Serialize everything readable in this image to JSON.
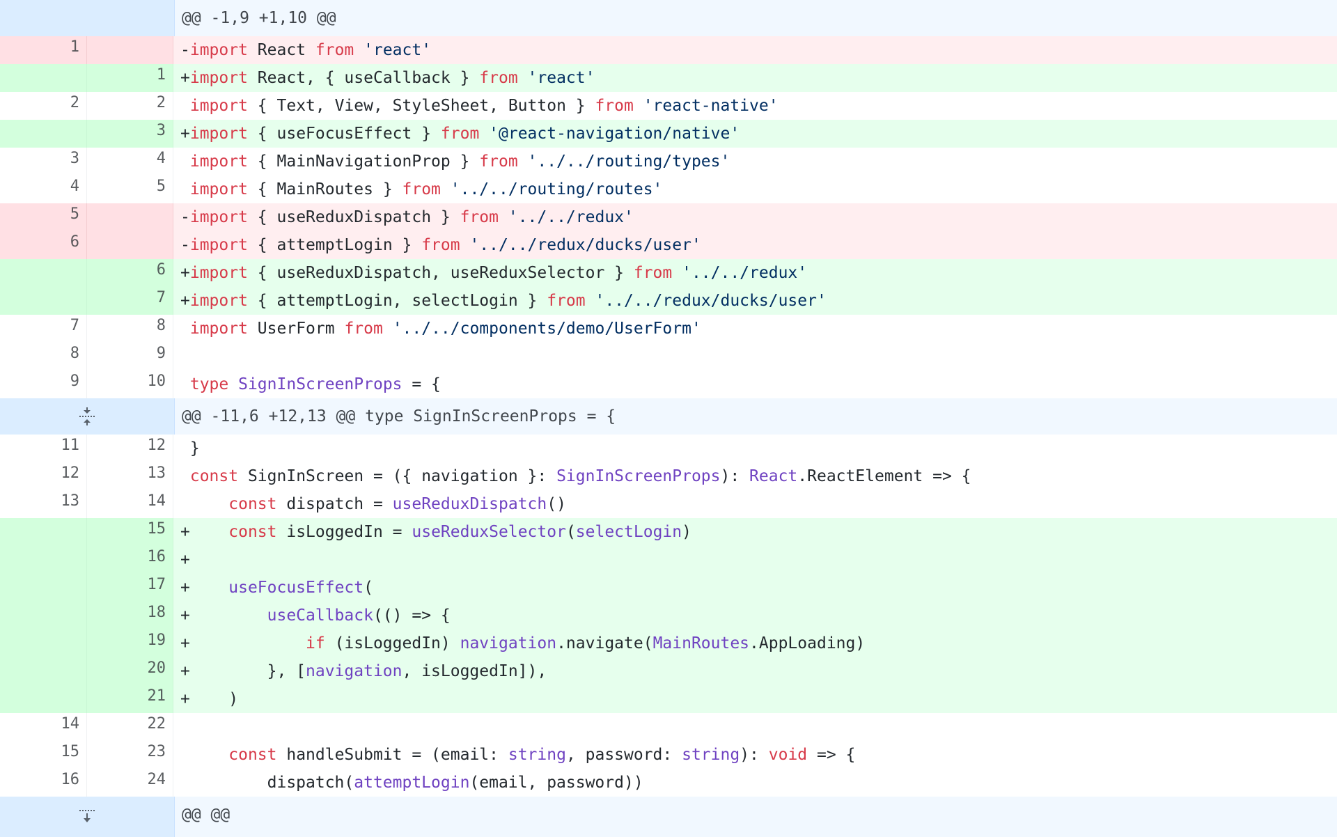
{
  "diff": {
    "rows": [
      {
        "type": "hunk",
        "header": "@@ -1,9 +1,10 @@",
        "expand": "none"
      },
      {
        "type": "del",
        "old": "1",
        "new": "",
        "tokens": [
          {
            "t": "-"
          },
          {
            "t": "import",
            "c": "k"
          },
          {
            "t": " React "
          },
          {
            "t": "from",
            "c": "k"
          },
          {
            "t": " "
          },
          {
            "t": "'react'",
            "c": "s"
          }
        ]
      },
      {
        "type": "add",
        "old": "",
        "new": "1",
        "tokens": [
          {
            "t": "+"
          },
          {
            "t": "import",
            "c": "k"
          },
          {
            "t": " React, { useCallback } "
          },
          {
            "t": "from",
            "c": "k"
          },
          {
            "t": " "
          },
          {
            "t": "'react'",
            "c": "s"
          }
        ]
      },
      {
        "type": "ctx",
        "old": "2",
        "new": "2",
        "tokens": [
          {
            "t": " "
          },
          {
            "t": "import",
            "c": "k"
          },
          {
            "t": " { Text, View, StyleSheet, Button } "
          },
          {
            "t": "from",
            "c": "k"
          },
          {
            "t": " "
          },
          {
            "t": "'react-native'",
            "c": "s"
          }
        ]
      },
      {
        "type": "add",
        "old": "",
        "new": "3",
        "tokens": [
          {
            "t": "+"
          },
          {
            "t": "import",
            "c": "k"
          },
          {
            "t": " { useFocusEffect } "
          },
          {
            "t": "from",
            "c": "k"
          },
          {
            "t": " "
          },
          {
            "t": "'@react-navigation/native'",
            "c": "s"
          }
        ]
      },
      {
        "type": "ctx",
        "old": "3",
        "new": "4",
        "tokens": [
          {
            "t": " "
          },
          {
            "t": "import",
            "c": "k"
          },
          {
            "t": " { MainNavigationProp } "
          },
          {
            "t": "from",
            "c": "k"
          },
          {
            "t": " "
          },
          {
            "t": "'../../routing/types'",
            "c": "s"
          }
        ]
      },
      {
        "type": "ctx",
        "old": "4",
        "new": "5",
        "tokens": [
          {
            "t": " "
          },
          {
            "t": "import",
            "c": "k"
          },
          {
            "t": " { MainRoutes } "
          },
          {
            "t": "from",
            "c": "k"
          },
          {
            "t": " "
          },
          {
            "t": "'../../routing/routes'",
            "c": "s"
          }
        ]
      },
      {
        "type": "del",
        "old": "5",
        "new": "",
        "tokens": [
          {
            "t": "-"
          },
          {
            "t": "import",
            "c": "k"
          },
          {
            "t": " { useReduxDispatch } "
          },
          {
            "t": "from",
            "c": "k"
          },
          {
            "t": " "
          },
          {
            "t": "'../../redux'",
            "c": "s"
          }
        ]
      },
      {
        "type": "del",
        "old": "6",
        "new": "",
        "tokens": [
          {
            "t": "-"
          },
          {
            "t": "import",
            "c": "k"
          },
          {
            "t": " { attemptLogin } "
          },
          {
            "t": "from",
            "c": "k"
          },
          {
            "t": " "
          },
          {
            "t": "'../../redux/ducks/user'",
            "c": "s"
          }
        ]
      },
      {
        "type": "add",
        "old": "",
        "new": "6",
        "tokens": [
          {
            "t": "+"
          },
          {
            "t": "import",
            "c": "k"
          },
          {
            "t": " { useReduxDispatch, useReduxSelector } "
          },
          {
            "t": "from",
            "c": "k"
          },
          {
            "t": " "
          },
          {
            "t": "'../../redux'",
            "c": "s"
          }
        ]
      },
      {
        "type": "add",
        "old": "",
        "new": "7",
        "tokens": [
          {
            "t": "+"
          },
          {
            "t": "import",
            "c": "k"
          },
          {
            "t": " { attemptLogin, selectLogin } "
          },
          {
            "t": "from",
            "c": "k"
          },
          {
            "t": " "
          },
          {
            "t": "'../../redux/ducks/user'",
            "c": "s"
          }
        ]
      },
      {
        "type": "ctx",
        "old": "7",
        "new": "8",
        "tokens": [
          {
            "t": " "
          },
          {
            "t": "import",
            "c": "k"
          },
          {
            "t": " UserForm "
          },
          {
            "t": "from",
            "c": "k"
          },
          {
            "t": " "
          },
          {
            "t": "'../../components/demo/UserForm'",
            "c": "s"
          }
        ]
      },
      {
        "type": "ctx",
        "old": "8",
        "new": "9",
        "tokens": [
          {
            "t": " "
          }
        ]
      },
      {
        "type": "ctx",
        "old": "9",
        "new": "10",
        "tokens": [
          {
            "t": " "
          },
          {
            "t": "type",
            "c": "k"
          },
          {
            "t": " "
          },
          {
            "t": "SignInScreenProps",
            "c": "f"
          },
          {
            "t": " = {"
          }
        ]
      },
      {
        "type": "hunk",
        "header": "@@ -11,6 +12,13 @@ type SignInScreenProps = {",
        "expand": "both"
      },
      {
        "type": "ctx",
        "old": "11",
        "new": "12",
        "tokens": [
          {
            "t": " }"
          }
        ]
      },
      {
        "type": "ctx",
        "old": "12",
        "new": "13",
        "tokens": [
          {
            "t": " "
          },
          {
            "t": "const",
            "c": "k"
          },
          {
            "t": " SignInScreen = ({ navigation }: "
          },
          {
            "t": "SignInScreenProps",
            "c": "f"
          },
          {
            "t": "): "
          },
          {
            "t": "React",
            "c": "f"
          },
          {
            "t": ".ReactElement => {"
          }
        ]
      },
      {
        "type": "ctx",
        "old": "13",
        "new": "14",
        "tokens": [
          {
            "t": "     "
          },
          {
            "t": "const",
            "c": "k"
          },
          {
            "t": " dispatch = "
          },
          {
            "t": "useReduxDispatch",
            "c": "f"
          },
          {
            "t": "()"
          }
        ]
      },
      {
        "type": "add",
        "old": "",
        "new": "15",
        "tokens": [
          {
            "t": "+    "
          },
          {
            "t": "const",
            "c": "k"
          },
          {
            "t": " isLoggedIn = "
          },
          {
            "t": "useReduxSelector",
            "c": "f"
          },
          {
            "t": "("
          },
          {
            "t": "selectLogin",
            "c": "f"
          },
          {
            "t": ")"
          }
        ]
      },
      {
        "type": "add",
        "old": "",
        "new": "16",
        "tokens": [
          {
            "t": "+"
          }
        ]
      },
      {
        "type": "add",
        "old": "",
        "new": "17",
        "tokens": [
          {
            "t": "+    "
          },
          {
            "t": "useFocusEffect",
            "c": "f"
          },
          {
            "t": "("
          }
        ]
      },
      {
        "type": "add",
        "old": "",
        "new": "18",
        "tokens": [
          {
            "t": "+        "
          },
          {
            "t": "useCallback",
            "c": "f"
          },
          {
            "t": "(() => {"
          }
        ]
      },
      {
        "type": "add",
        "old": "",
        "new": "19",
        "tokens": [
          {
            "t": "+            "
          },
          {
            "t": "if",
            "c": "k"
          },
          {
            "t": " (isLoggedIn) "
          },
          {
            "t": "navigation",
            "c": "f"
          },
          {
            "t": ".navigate("
          },
          {
            "t": "MainRoutes",
            "c": "f"
          },
          {
            "t": ".AppLoading)"
          }
        ]
      },
      {
        "type": "add",
        "old": "",
        "new": "20",
        "tokens": [
          {
            "t": "+        }, ["
          },
          {
            "t": "navigation",
            "c": "f"
          },
          {
            "t": ", isLoggedIn]),"
          }
        ]
      },
      {
        "type": "add",
        "old": "",
        "new": "21",
        "tokens": [
          {
            "t": "+    )"
          }
        ]
      },
      {
        "type": "ctx",
        "old": "14",
        "new": "22",
        "tokens": [
          {
            "t": " "
          }
        ]
      },
      {
        "type": "ctx",
        "old": "15",
        "new": "23",
        "tokens": [
          {
            "t": "     "
          },
          {
            "t": "const",
            "c": "k"
          },
          {
            "t": " handleSubmit = (email: "
          },
          {
            "t": "string",
            "c": "f"
          },
          {
            "t": ", password: "
          },
          {
            "t": "string",
            "c": "f"
          },
          {
            "t": "): "
          },
          {
            "t": "void",
            "c": "k"
          },
          {
            "t": " => {"
          }
        ]
      },
      {
        "type": "ctx",
        "old": "16",
        "new": "24",
        "tokens": [
          {
            "t": "         dispatch("
          },
          {
            "t": "attemptLogin",
            "c": "f"
          },
          {
            "t": "(email, password))"
          }
        ]
      },
      {
        "type": "hunk",
        "header": "@@ @@",
        "expand": "down"
      }
    ]
  }
}
